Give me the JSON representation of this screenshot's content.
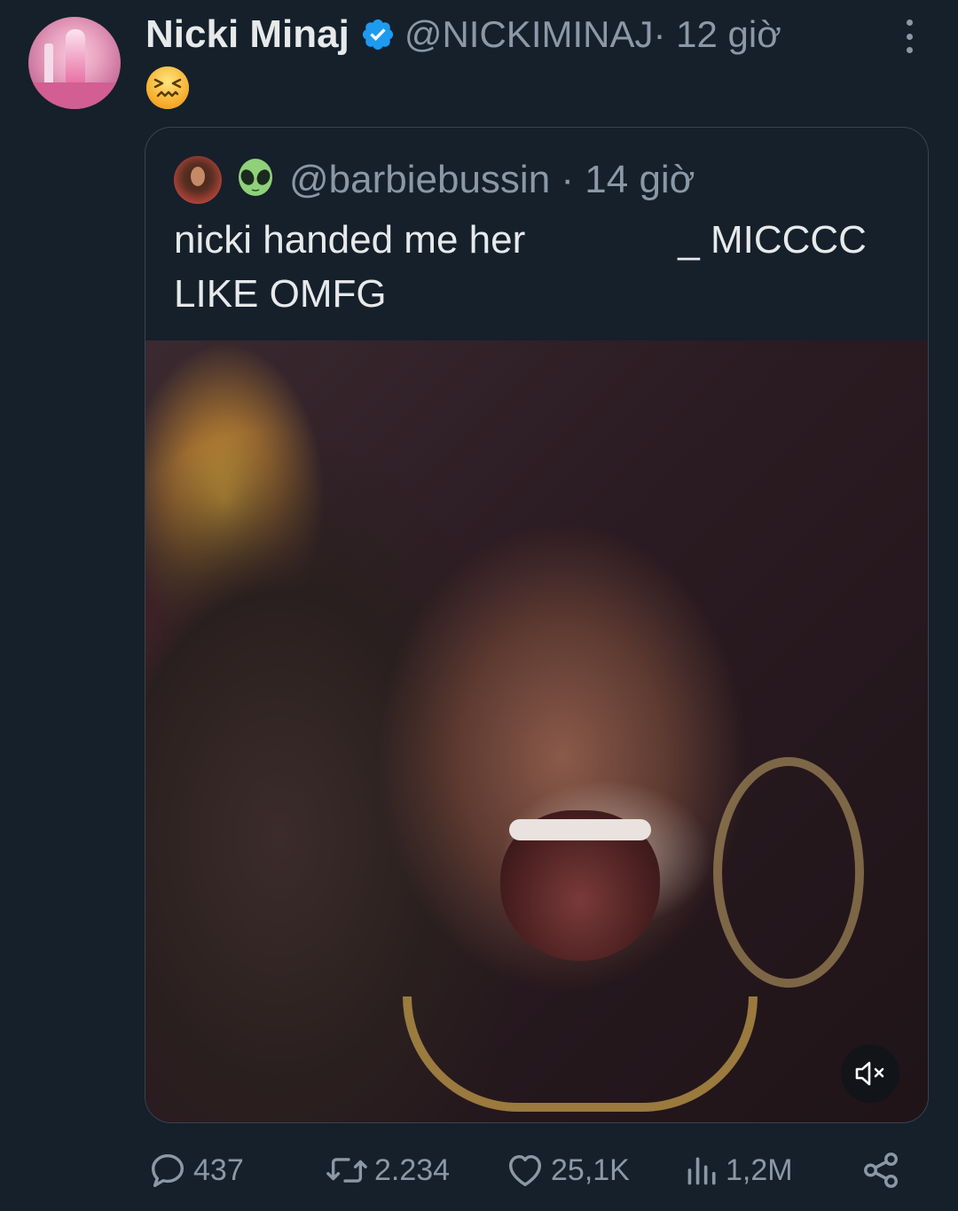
{
  "post": {
    "author_name": "Nicki Minaj",
    "author_handle": "@NICKIMINAJ",
    "time": " · 12 giờ",
    "verified": true,
    "body_emoji": "😖"
  },
  "quoted": {
    "handle": "@barbiebussin",
    "time": " · 14 giờ",
    "name_emoji": "👽",
    "text_line1_a": "nicki handed me her",
    "text_line1_b": "_ MICCCC",
    "text_line2": "LIKE OMFG",
    "media": {
      "type": "video",
      "muted": true
    }
  },
  "actions": {
    "reply_count": "437",
    "repost_count": "2.234",
    "like_count": "25,1K",
    "view_count": "1,2M"
  },
  "colors": {
    "background": "#15202b",
    "primary_text": "#e7e9ea",
    "secondary_text": "#8b98a5",
    "border": "#38444d",
    "verified": "#1d9bf0"
  },
  "icons": [
    "verified-badge-icon",
    "more-options-icon",
    "reply-icon",
    "repost-icon",
    "like-icon",
    "views-icon",
    "share-icon",
    "mute-icon"
  ]
}
